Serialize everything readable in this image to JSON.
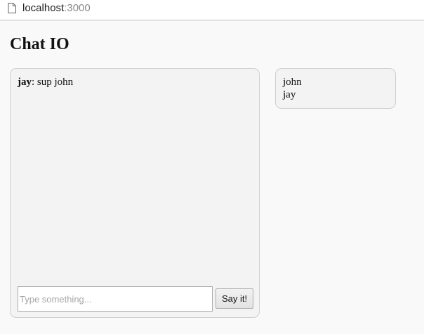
{
  "browser": {
    "url_host": "localhost",
    "url_port": ":3000",
    "page_icon": "page-icon"
  },
  "page": {
    "title": "Chat IO"
  },
  "chat": {
    "messages": [
      {
        "user": "jay",
        "separator": ":",
        "text": " sup john"
      }
    ],
    "input_value": "",
    "input_placeholder": "Type something...",
    "send_label": "Say it!"
  },
  "users": [
    {
      "name": "john"
    },
    {
      "name": "jay"
    }
  ]
}
